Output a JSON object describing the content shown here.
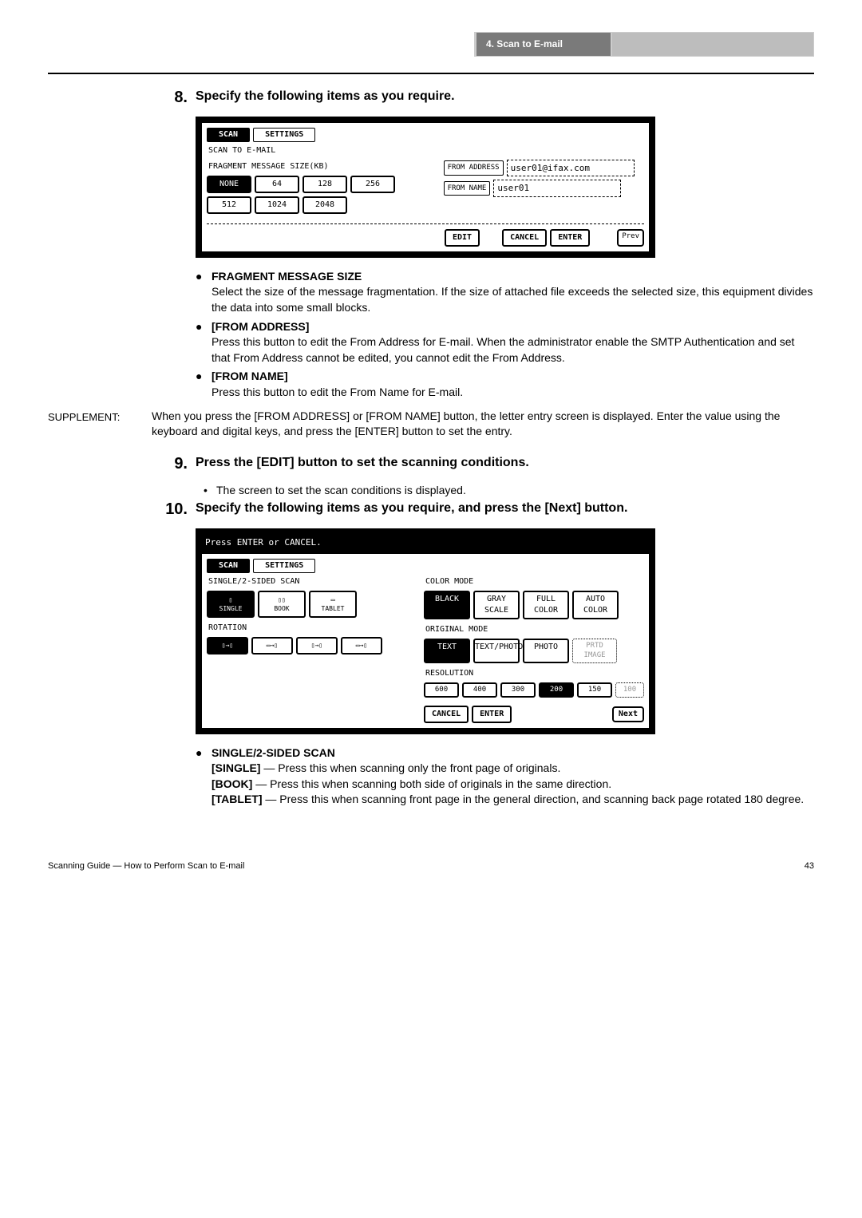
{
  "header": {
    "section_title": "4. Scan to E-mail"
  },
  "step8": {
    "num": "8.",
    "text": "Specify the following items as you require."
  },
  "screen1": {
    "tabs": {
      "scan": "SCAN",
      "settings": "SETTINGS"
    },
    "title": "SCAN TO E-MAIL",
    "frag_label": "FRAGMENT MESSAGE SIZE(KB)",
    "sizes": [
      "NONE",
      "64",
      "128",
      "256",
      "512",
      "1024",
      "2048"
    ],
    "from_addr_label": "FROM ADDRESS",
    "from_addr_val": "user01@ifax.com",
    "from_name_label": "FROM NAME",
    "from_name_val": "user01",
    "edit": "EDIT",
    "cancel": "CANCEL",
    "enter": "ENTER",
    "prev": "Prev"
  },
  "bullets1": {
    "frag_title": "FRAGMENT MESSAGE SIZE",
    "frag_body": "Select the size of the message fragmentation.  If the size of attached file exceeds the selected size, this equipment divides the data into some small blocks.",
    "from_addr_title": "[FROM ADDRESS]",
    "from_addr_body": "Press this button to edit the From Address for E-mail.  When the administrator enable the SMTP Authentication and set that From Address cannot be edited, you cannot edit the From Address.",
    "from_name_title": "[FROM NAME]",
    "from_name_body": "Press this button to edit the From Name for E-mail."
  },
  "supplement": {
    "label": "SUPPLEMENT:",
    "body": "When you press the [FROM ADDRESS] or [FROM NAME] button, the letter entry screen is displayed. Enter the value using the keyboard and digital keys, and press the [ENTER] button to set the entry."
  },
  "step9": {
    "num": "9.",
    "text": "Press the [EDIT] button to set the scanning conditions.",
    "sub": "The screen to set the scan conditions is displayed."
  },
  "step10": {
    "num": "10.",
    "text": "Specify the following items as you require, and press the [Next] button."
  },
  "screen2": {
    "prompt": "Press ENTER or CANCEL.",
    "tabs": {
      "scan": "SCAN",
      "settings": "SETTINGS"
    },
    "single_label": "SINGLE/2-SIDED SCAN",
    "single_opts": [
      "SINGLE",
      "BOOK",
      "TABLET"
    ],
    "rotation_label": "ROTATION",
    "color_label": "COLOR MODE",
    "color_opts": [
      "BLACK",
      "GRAY SCALE",
      "FULL COLOR",
      "AUTO COLOR"
    ],
    "orig_label": "ORIGINAL MODE",
    "orig_opts": [
      "TEXT",
      "TEXT/PHOTO",
      "PHOTO",
      "PRTD IMAGE"
    ],
    "res_label": "RESOLUTION",
    "res_opts": [
      "600",
      "400",
      "300",
      "200",
      "150",
      "100"
    ],
    "cancel": "CANCEL",
    "enter": "ENTER",
    "next": "Next"
  },
  "bullets2": {
    "title": "SINGLE/2-SIDED SCAN",
    "single_label": "[SINGLE]",
    "single_body": " — Press this when scanning only the front page of originals.",
    "book_label": "[BOOK]",
    "book_body": " — Press this when scanning both side of originals in the same direction.",
    "tablet_label": "[TABLET]",
    "tablet_body": " — Press this when scanning front page in the general direction, and scanning back page rotated 180 degree."
  },
  "footer": {
    "left": "Scanning Guide — How to Perform Scan to E-mail",
    "right": "43"
  }
}
